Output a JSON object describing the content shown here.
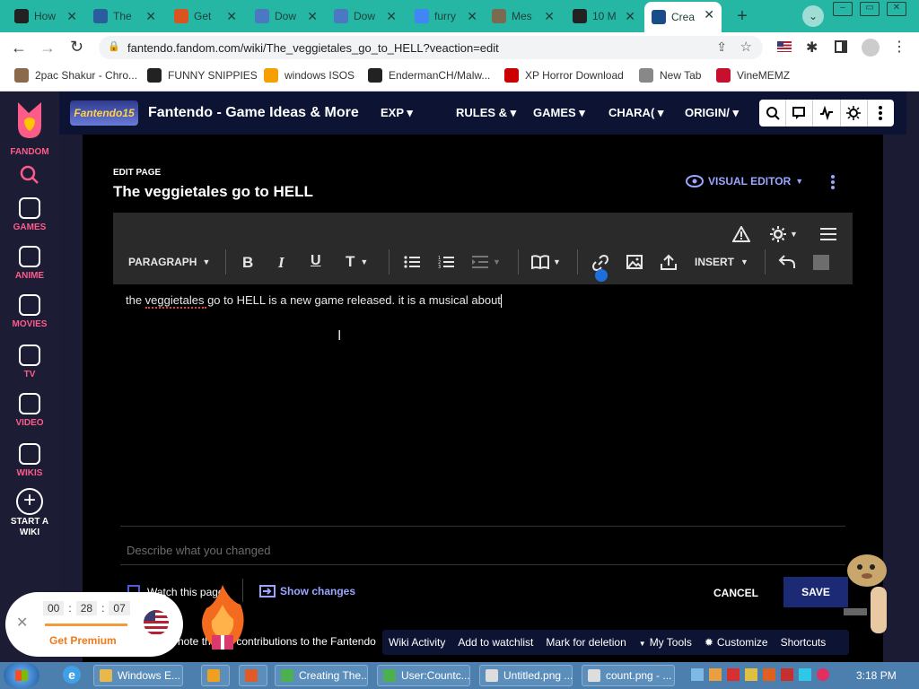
{
  "browser": {
    "tabs": [
      {
        "title": "How",
        "icon": "youtube-icon",
        "color": "#222222"
      },
      {
        "title": "The",
        "icon": "adl-icon",
        "color": "#2a5d9e"
      },
      {
        "title": "Get",
        "icon": "fire-icon",
        "color": "#d9541e"
      },
      {
        "title": "Dow",
        "icon": "globe-icon",
        "color": "#4a78c2"
      },
      {
        "title": "Dow",
        "icon": "globe-icon",
        "color": "#4a78c2"
      },
      {
        "title": "furry",
        "icon": "google-icon",
        "color": "#4285f4"
      },
      {
        "title": "Mes",
        "icon": "mail-icon",
        "color": "#7a6a50"
      },
      {
        "title": "10 M",
        "icon": "ten-icon",
        "color": "#222222"
      },
      {
        "title": "Crea",
        "icon": "fandom-tab-icon",
        "color": "#1a4c8a"
      }
    ],
    "address": "fantendo.fandom.com/wiki/The_veggietales_go_to_HELL?veaction=edit",
    "bookmarks": [
      {
        "label": "2pac Shakur - Chro...",
        "color": "#8a6a4a",
        "icon": "person-icon"
      },
      {
        "label": "FUNNY SNIPPIES",
        "color": "#222222",
        "icon": "h-icon"
      },
      {
        "label": "windows ISOS",
        "color": "#f5a000",
        "icon": "ph-icon"
      },
      {
        "label": "EndermanCH/Malw...",
        "color": "#222222",
        "icon": "yp-icon"
      },
      {
        "label": "XP Horror Download",
        "color": "#cc0000",
        "icon": "x-icon"
      },
      {
        "label": "New Tab",
        "color": "#888888",
        "icon": "newtab-icon"
      },
      {
        "label": "VineMEMZ",
        "color": "#c8102e",
        "icon": "r-icon"
      }
    ]
  },
  "fandom_rail": {
    "brand": "FANDOM",
    "items": [
      "GAMES",
      "ANIME",
      "MOVIES",
      "TV",
      "VIDEO",
      "WIKIS"
    ],
    "start_wiki": "START A WIKI"
  },
  "wiki_nav": {
    "logo": "Fantendo15",
    "title": "Fantendo - Game Ideas & More",
    "menus": [
      "EXP",
      "RULES &",
      "GAMES",
      "CHARA(",
      "ORIGIN/"
    ]
  },
  "editor": {
    "kicker": "EDIT PAGE",
    "page_title": "The veggietales go to HELL",
    "mode": "VISUAL EDITOR",
    "format": "PARAGRAPH",
    "insert": "INSERT",
    "content": "the veggietales go to HELL is a new game released. it is a musical about",
    "summary_placeholder": "Describe what you changed",
    "watch_label": "Watch this page",
    "show_changes": "Show changes",
    "cancel": "CANCEL",
    "save": "SAVE",
    "notice": "note that all contributions to the Fantendo"
  },
  "wiki_toolbar": [
    "Wiki Activity",
    "Add to watchlist",
    "Mark for deletion",
    "My Tools",
    "Customize",
    "Shortcuts"
  ],
  "timer": {
    "h": "00",
    "m": "28",
    "s": "07",
    "cta": "Get Premium"
  },
  "taskbar": {
    "buttons": [
      {
        "label": "Windows E...",
        "color": "#e8b94a"
      },
      {
        "label": "",
        "color": "#f0a020"
      },
      {
        "label": "",
        "color": "#e05a2a"
      },
      {
        "label": "Creating The...",
        "color": "#4caf50"
      },
      {
        "label": "User:Countc...",
        "color": "#4caf50"
      },
      {
        "label": "Untitled.png ...",
        "color": "#dddddd"
      },
      {
        "label": "count.png - ...",
        "color": "#dddddd"
      }
    ],
    "clock": "3:18 PM"
  }
}
